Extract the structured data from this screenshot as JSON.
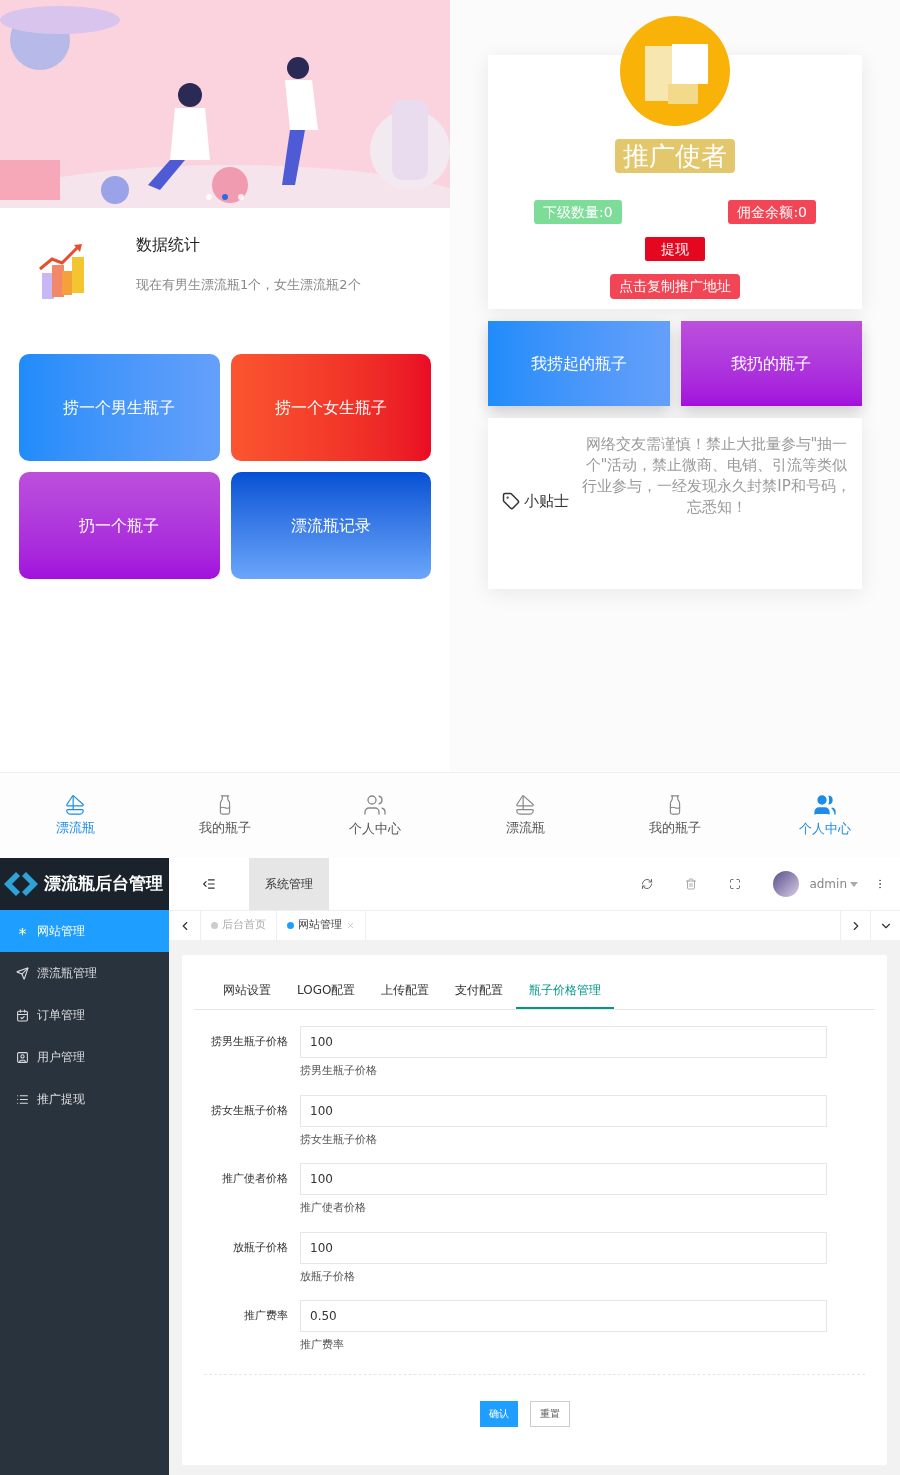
{
  "left_phone": {
    "banner": {
      "dots": [
        {
          "selected": false
        },
        {
          "selected": true
        },
        {
          "selected": false
        }
      ]
    },
    "stats": {
      "title": "数据统计",
      "text": "现在有男生漂流瓶1个，女生漂流瓶2个"
    },
    "actions": [
      {
        "label": "捞一个男生瓶子",
        "kind": "blue"
      },
      {
        "label": "捞一个女生瓶子",
        "kind": "red"
      },
      {
        "label": "扔一个瓶子",
        "kind": "purple"
      },
      {
        "label": "漂流瓶记录",
        "kind": "navy"
      }
    ]
  },
  "right_phone": {
    "promo_card": {
      "badge": "推广使者",
      "sub_count": "下级数量:0",
      "balance": "佣金余额:0",
      "withdraw": "提现",
      "copy_link": "点击复制推广地址"
    },
    "bottle_buttons": [
      {
        "label": "我捞起的瓶子",
        "kind": "blue"
      },
      {
        "label": "我扔的瓶子",
        "kind": "purple"
      }
    ],
    "tip": {
      "label": "小贴士",
      "text": "网络交友需谨慎！禁止大批量参与\"抽一个\"活动，禁止微商、电销、引流等类似行业参与，一经发现永久封禁IP和号码，忘悉知！"
    }
  },
  "bottom_navs": [
    [
      {
        "label": "漂流瓶",
        "kind": "drift",
        "selected": true
      },
      {
        "label": "我的瓶子",
        "kind": "bottle",
        "selected": false
      },
      {
        "label": "个人中心",
        "kind": "user",
        "selected": false
      }
    ],
    [
      {
        "label": "漂流瓶",
        "kind": "drift",
        "selected": false
      },
      {
        "label": "我的瓶子",
        "kind": "bottle",
        "selected": false
      },
      {
        "label": "个人中心",
        "kind": "user",
        "selected": true
      }
    ]
  ],
  "admin": {
    "logo_title": "漂流瓶后台管理",
    "sidebar": {
      "items": [
        {
          "label": "网站管理",
          "kind": "gear",
          "selected": true
        },
        {
          "label": "漂流瓶管理",
          "kind": "rocket",
          "selected": false
        },
        {
          "label": "订单管理",
          "kind": "calendar",
          "selected": false
        },
        {
          "label": "用户管理",
          "kind": "contact",
          "selected": false
        },
        {
          "label": "推广提现",
          "kind": "list",
          "selected": false
        }
      ]
    },
    "header": {
      "menu": [
        {
          "label": "系统管理",
          "selected": true
        }
      ],
      "user": "admin"
    },
    "page_tabs": [
      {
        "label": "后台首页",
        "selected": false,
        "closable": false
      },
      {
        "label": "网站管理",
        "selected": true,
        "closable": true
      }
    ],
    "form_tabs": [
      {
        "label": "网站设置",
        "selected": false
      },
      {
        "label": "LOGO配置",
        "selected": false
      },
      {
        "label": "上传配置",
        "selected": false
      },
      {
        "label": "支付配置",
        "selected": false
      },
      {
        "label": "瓶子价格管理",
        "selected": true
      }
    ],
    "fields": [
      {
        "label": "捞男生瓶子价格",
        "value": "100",
        "hint": "捞男生瓶子价格"
      },
      {
        "label": "捞女生瓶子价格",
        "value": "100",
        "hint": "捞女生瓶子价格"
      },
      {
        "label": "推广使者价格",
        "value": "100",
        "hint": "推广使者价格"
      },
      {
        "label": "放瓶子价格",
        "value": "100",
        "hint": "放瓶子价格"
      },
      {
        "label": "推广费率",
        "value": "0.50",
        "hint": "推广费率"
      }
    ],
    "buttons": [
      {
        "label": "确认",
        "kind": "primary"
      },
      {
        "label": "重置",
        "kind": "secondary"
      }
    ]
  }
}
